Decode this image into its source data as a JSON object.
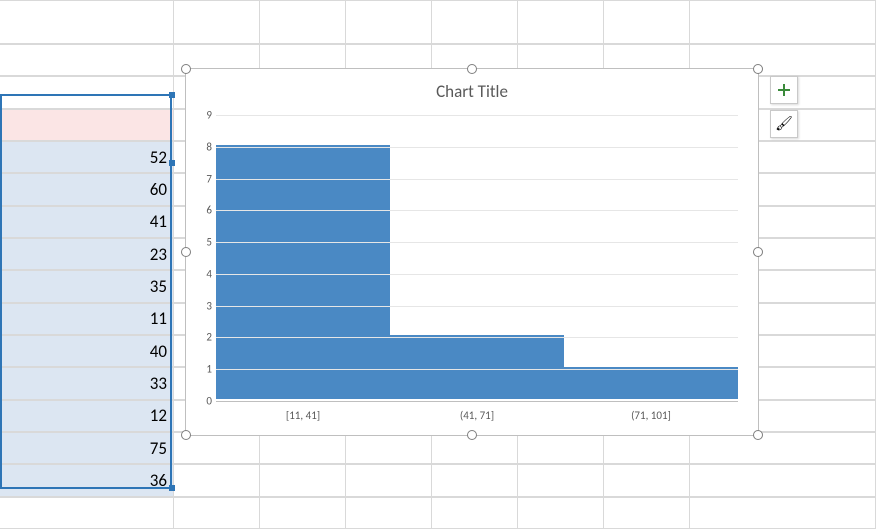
{
  "spreadsheet": {
    "columnB": [
      "52",
      "60",
      "41",
      "23",
      "35",
      "11",
      "40",
      "33",
      "12",
      "75",
      "36"
    ]
  },
  "chart": {
    "title": "Chart Title"
  },
  "side_buttons": {
    "add": "plus-icon",
    "style": "paintbrush-icon"
  },
  "chart_data": {
    "type": "bar",
    "title": "Chart Title",
    "xlabel": "",
    "ylabel": "",
    "categories": [
      "[11, 41]",
      "(41, 71]",
      "(71, 101]"
    ],
    "values": [
      8,
      2,
      1
    ],
    "ylim": [
      0,
      9
    ],
    "yticks": [
      0,
      1,
      2,
      3,
      4,
      5,
      6,
      7,
      8,
      9
    ]
  }
}
